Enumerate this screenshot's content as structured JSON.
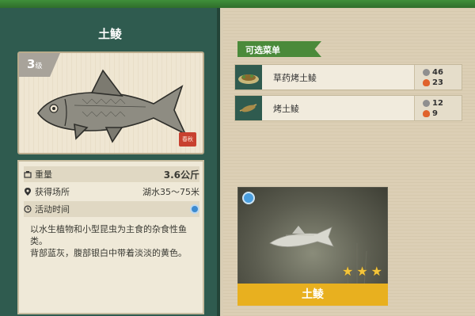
{
  "fish": {
    "name": "土鲮",
    "level": "3",
    "level_unit": "级",
    "stamp": "春秋"
  },
  "info": {
    "weight_label": "重量",
    "weight_value": "3.6公斤",
    "location_label": "获得场所",
    "location_value": "湖水35～75米",
    "time_label": "活动时间",
    "description": "以水生植物和小型昆虫为主食的杂食性鱼类。\n背部蓝灰，腹部银白中带着淡淡的黄色。"
  },
  "menu": {
    "title": "可选菜单",
    "items": [
      {
        "name": "草药烤土鲮",
        "stat1": "46",
        "stat2": "23"
      },
      {
        "name": "烤土鲮",
        "stat1": "12",
        "stat2": "9"
      }
    ]
  },
  "photo": {
    "label": "土鲮",
    "stars": 3
  },
  "colors": {
    "panel": "#2f5b4f",
    "accent_green": "#4a8a3a",
    "gold": "#e8b01f"
  }
}
